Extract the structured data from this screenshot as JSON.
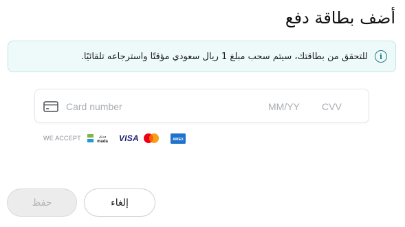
{
  "page": {
    "title": "أضف بطاقة دفع"
  },
  "notice": {
    "icon": "info-icon",
    "text": "للتحقق من بطاقتك، سيتم سحب مبلغ 1 ريال سعودي مؤقتًا واسترجاعه تلقائيًا."
  },
  "card_form": {
    "card_icon": "credit-card-icon",
    "number_placeholder": "Card number",
    "expiry_placeholder": "MM/YY",
    "cvv_placeholder": "CVV"
  },
  "accepted": {
    "label": "WE ACCEPT",
    "logos": {
      "mada_top": "مدى",
      "mada_bottom": "mada",
      "visa": "VISA",
      "mastercard": "mastercard-logo",
      "amex": "AMEX"
    }
  },
  "actions": {
    "save_label": "حفظ",
    "cancel_label": "إلغاء"
  },
  "colors": {
    "notice_bg": "#eef9fa",
    "notice_border": "#bfe6e8",
    "accent": "#1f7d83",
    "disabled_bg": "#ececec",
    "disabled_text": "#b5b5b5"
  }
}
